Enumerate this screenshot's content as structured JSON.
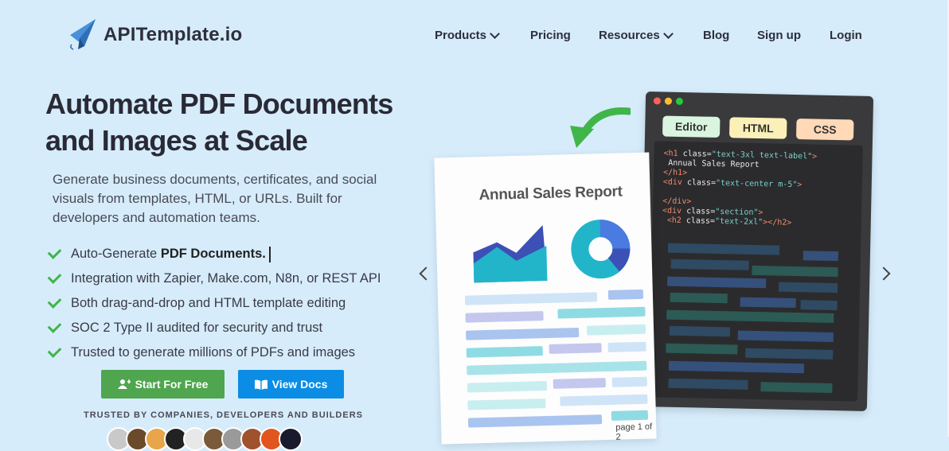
{
  "header": {
    "brand": "APITemplate.io",
    "nav": [
      {
        "label": "Products",
        "has_dropdown": true
      },
      {
        "label": "Pricing",
        "has_dropdown": false
      },
      {
        "label": "Resources",
        "has_dropdown": true
      },
      {
        "label": "Blog",
        "has_dropdown": false
      },
      {
        "label": "Sign up",
        "has_dropdown": false
      },
      {
        "label": "Login",
        "has_dropdown": false
      }
    ]
  },
  "hero": {
    "headline_line1": "Automate PDF Documents",
    "headline_line2": "and Images at Scale",
    "subtitle": "Generate business documents, certificates, and social visuals from templates, HTML, or URLs. Built for developers and automation teams.",
    "features": [
      {
        "prefix": "Auto-Generate ",
        "bold": "PDF Documents."
      },
      {
        "prefix": "Integration with Zapier, Make.com, N8n, or REST API",
        "bold": ""
      },
      {
        "prefix": "Both drag-and-drop and HTML template editing",
        "bold": ""
      },
      {
        "prefix": "SOC 2 Type II audited for security and trust",
        "bold": ""
      },
      {
        "prefix": "Trusted to generate millions of PDFs and images",
        "bold": ""
      }
    ],
    "cta_primary": "Start For Free",
    "cta_secondary": "View Docs",
    "trusted_label": "TRUSTED BY COMPANIES, DEVELOPERS AND BUILDERS"
  },
  "illustration": {
    "editor_tabs": [
      "Editor",
      "HTML",
      "CSS"
    ],
    "doc_title": "Annual Sales Report",
    "page_label": "page 1 of 2",
    "code_lines": [
      [
        "<h1 ",
        "class=",
        "\"text-3xl text-label\"",
        ">"
      ],
      [
        "",
        " Annual Sales Report",
        "",
        ""
      ],
      [
        "</h1>",
        "",
        "",
        ""
      ],
      [
        "<div ",
        "class=",
        "\"text-center m-5\"",
        ">"
      ],
      [
        "",
        "",
        "",
        ""
      ],
      [
        "</div>",
        "",
        "",
        ""
      ],
      [
        "<div ",
        "class=",
        "\"section\"",
        ">"
      ],
      [
        " <h2 ",
        "class=",
        "\"text-2xl\"",
        "></h2>"
      ]
    ]
  },
  "colors": {
    "background": "#d6ecfb",
    "primary_button": "#4fa64f",
    "secondary_button": "#0b8de6",
    "check": "#3fb54a"
  }
}
